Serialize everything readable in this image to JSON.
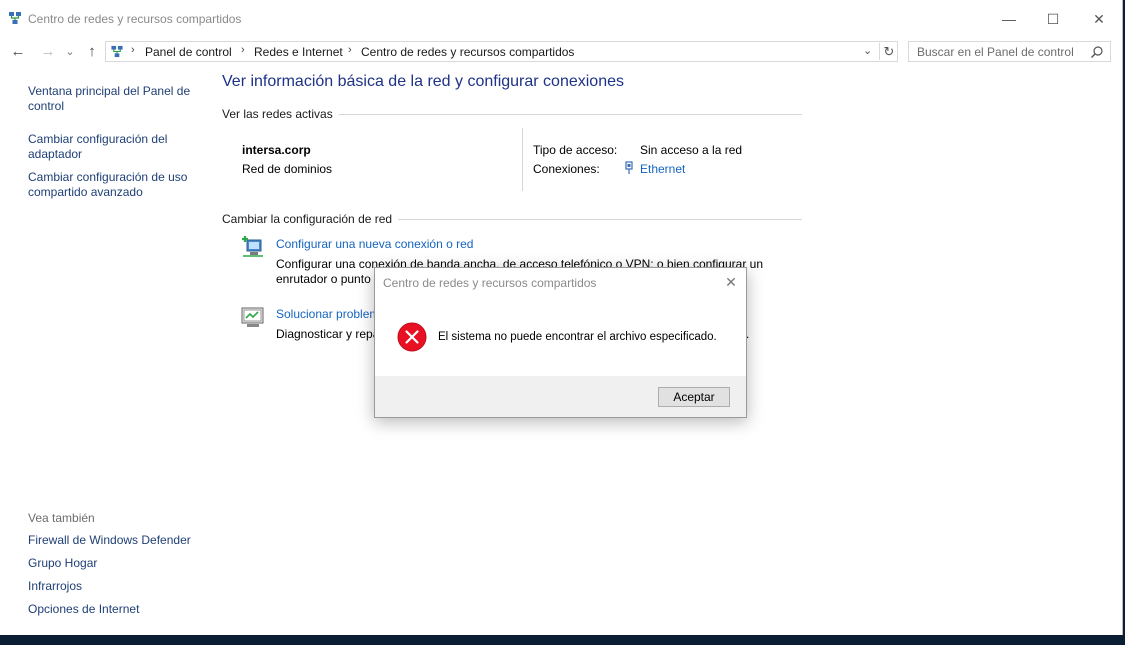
{
  "window": {
    "title": "Centro de redes y recursos compartidos",
    "controls": {
      "minimize": "—",
      "maximize": "☐",
      "close": "✕"
    }
  },
  "address_bar": {
    "breadcrumb": [
      "Panel de control",
      "Redes e Internet",
      "Centro de redes y recursos compartidos"
    ],
    "separator": "›",
    "dropdown": "⌄",
    "refresh": "↻"
  },
  "nav": {
    "back": "←",
    "forward": "→",
    "recent": "⌄",
    "up": "↑"
  },
  "search": {
    "placeholder": "Buscar en el Panel de control"
  },
  "left_pane": {
    "links": [
      "Ventana principal del Panel de control",
      "Cambiar configuración del adaptador",
      "Cambiar configuración de uso compartido avanzado"
    ],
    "see_also_heading": "Vea también",
    "see_also": [
      "Firewall de Windows Defender",
      "Grupo Hogar",
      "Infrarrojos",
      "Opciones de Internet"
    ]
  },
  "main": {
    "title": "Ver información básica de la red y configurar conexiones",
    "active_networks_heading": "Ver las redes activas",
    "network": {
      "name": "intersa.corp",
      "category": "Red de dominios",
      "access_type_label": "Tipo de acceso:",
      "access_type_value": "Sin acceso a la red",
      "connections_label": "Conexiones:",
      "connections_value": "Ethernet"
    },
    "change_settings_heading": "Cambiar la configuración de red",
    "tasks": [
      {
        "link": "Configurar una nueva conexión o red",
        "desc_line1": "Configurar una conexión de banda ancha, de acceso telefónico o VPN; o bien configurar un",
        "desc_line2": "enrutador o punto"
      },
      {
        "link": "Solucionar problem",
        "desc_line1": "Diagnosticar y repa",
        "desc_tail": "."
      }
    ]
  },
  "dialog": {
    "title": "Centro de redes y recursos compartidos",
    "close": "✕",
    "message": "El sistema no puede encontrar el archivo especificado.",
    "ok_button": "Aceptar",
    "icon": "error-icon",
    "icon_color": "#e81123"
  }
}
